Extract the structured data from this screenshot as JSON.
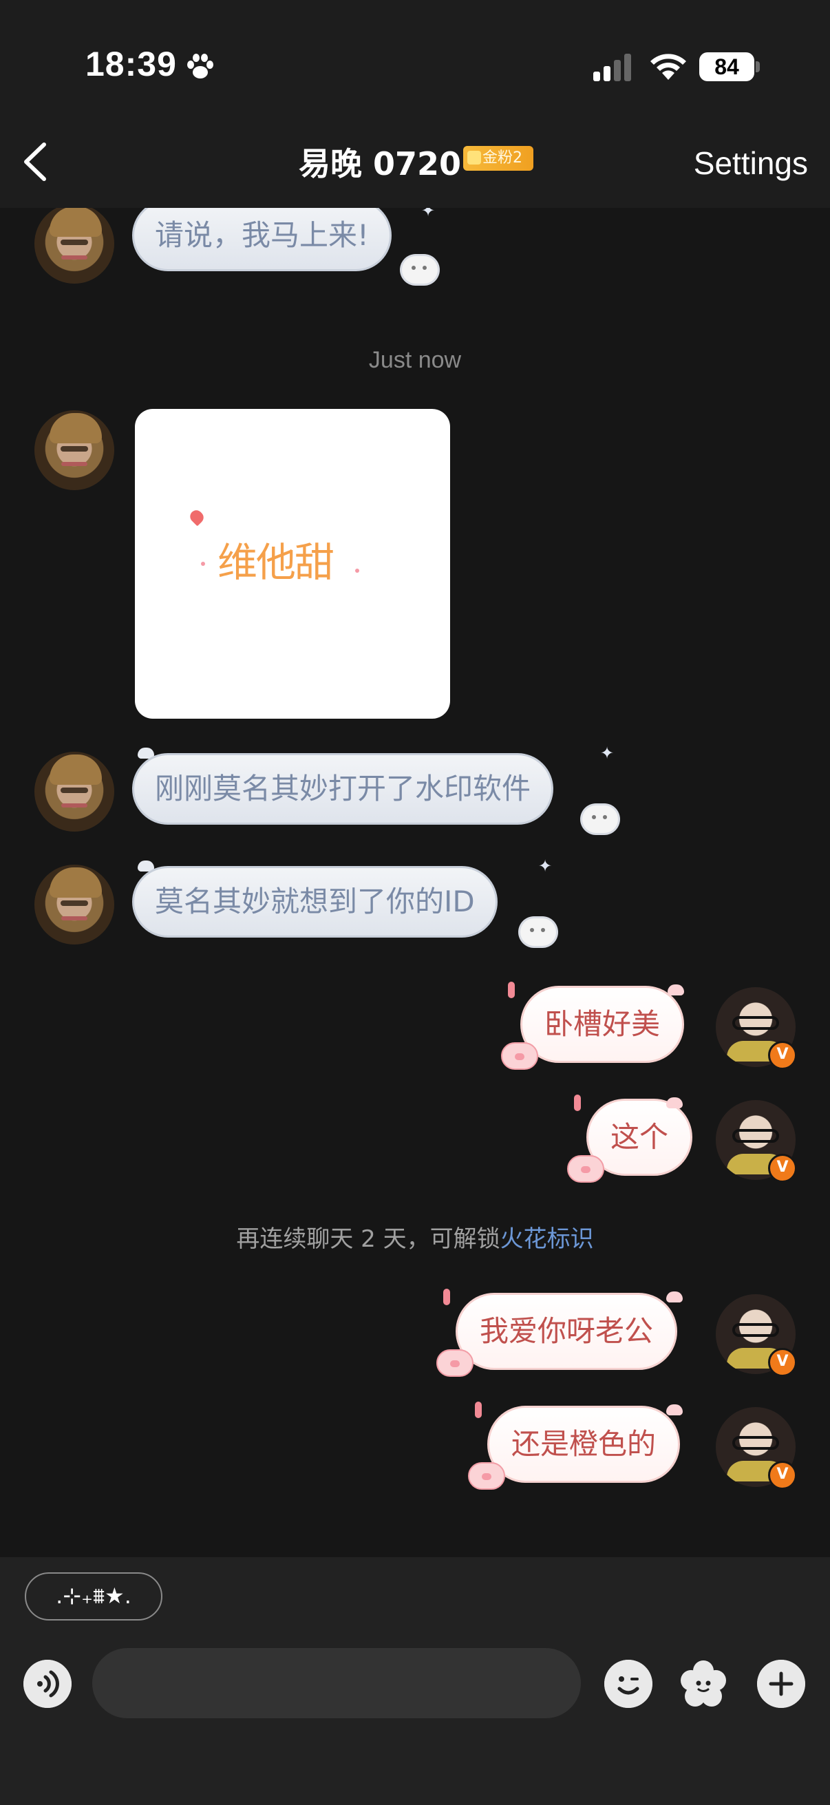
{
  "status_bar": {
    "time": "18:39",
    "battery": "84"
  },
  "nav": {
    "title": "易晚 0720",
    "fan_badge": "金粉2",
    "settings": "Settings"
  },
  "messages": [
    {
      "side": "left",
      "type": "text",
      "text": "请说，我马上来!"
    },
    {
      "type": "timestamp",
      "text": "Just now"
    },
    {
      "side": "left",
      "type": "image",
      "image_text": "维他甜"
    },
    {
      "side": "left",
      "type": "text",
      "text": "刚刚莫名其妙打开了水印软件"
    },
    {
      "side": "left",
      "type": "text",
      "text": "莫名其妙就想到了你的ID"
    },
    {
      "side": "right",
      "type": "text",
      "text": "卧槽好美"
    },
    {
      "side": "right",
      "type": "text",
      "text": "这个"
    },
    {
      "type": "notice",
      "text": "再连续聊天 2 天，可解锁",
      "link": "火花标识"
    },
    {
      "side": "right",
      "type": "text",
      "text": "我爱你呀老公"
    },
    {
      "side": "right",
      "type": "text",
      "text": "还是橙色的"
    }
  ],
  "quick_chip": ".⊹₊⩩★.",
  "input": {
    "placeholder": ""
  },
  "avatars": {
    "verified_badge": "V"
  },
  "colors": {
    "background": "#161616",
    "left_bubble_text": "#7a8aa6",
    "right_bubble_text": "#c0504d",
    "link": "#6c97d6",
    "badge": "#f07a1a"
  }
}
